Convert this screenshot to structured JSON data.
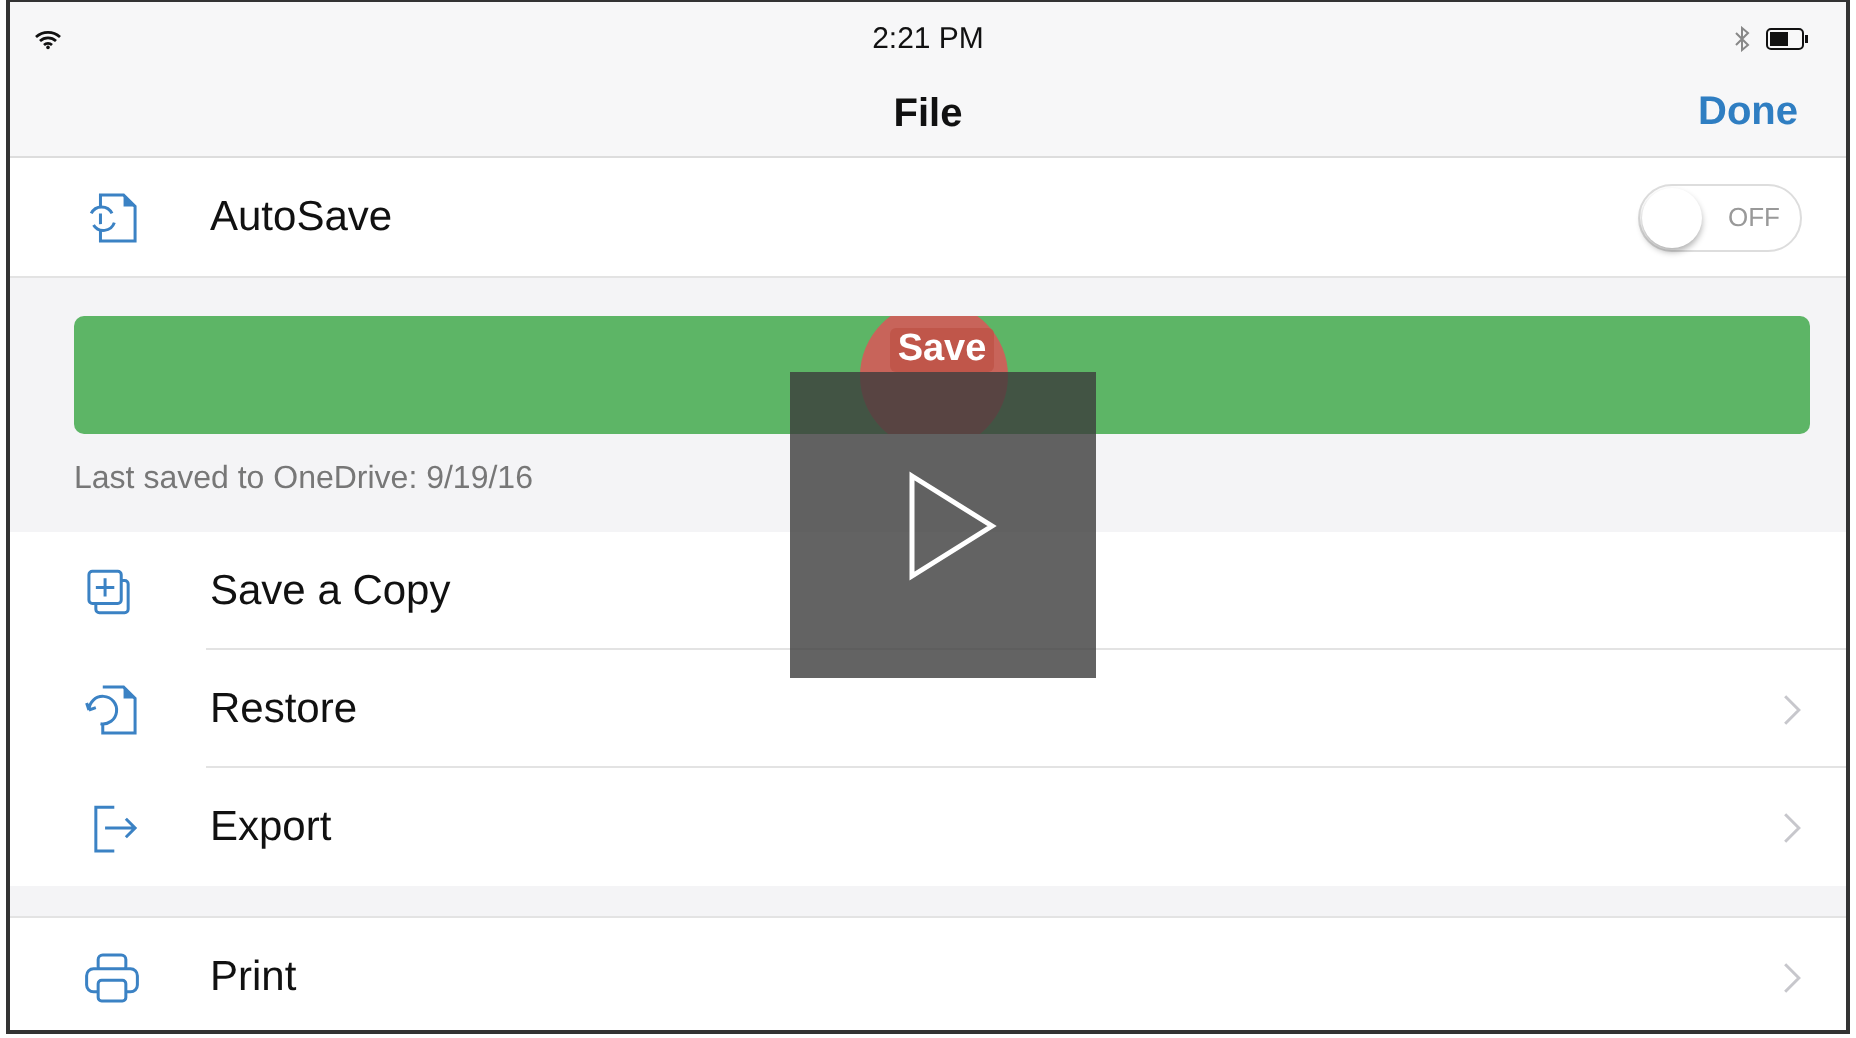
{
  "status_bar": {
    "time": "2:21 PM"
  },
  "nav_bar": {
    "title": "File",
    "done": "Done"
  },
  "autosave": {
    "label": "AutoSave",
    "on": false,
    "toggle_text": "OFF"
  },
  "save_button": {
    "label": "Save"
  },
  "last_saved": "Last saved to OneDrive: 9/19/16",
  "groups": [
    [
      {
        "label": "Save a Copy",
        "kind": "copy",
        "chevron": false
      },
      {
        "label": "Restore",
        "kind": "restore",
        "chevron": true
      },
      {
        "label": "Export",
        "kind": "export",
        "chevron": true
      }
    ],
    [
      {
        "label": "Print",
        "kind": "print",
        "chevron": true
      }
    ]
  ],
  "video_overlay": {
    "kind": "play"
  }
}
